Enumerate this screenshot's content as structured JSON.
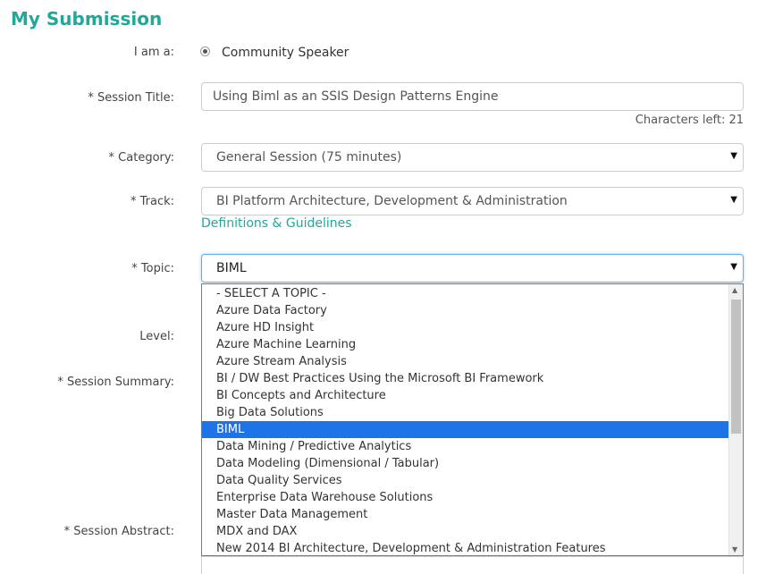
{
  "page": {
    "title": "My Submission"
  },
  "form": {
    "iam_label": "I am a:",
    "iam_value": "Community Speaker",
    "session_title_label": "* Session Title:",
    "session_title_value": "Using Biml as an SSIS Design Patterns Engine",
    "chars_left": "Characters left: 21",
    "category_label": "* Category:",
    "category_value": "General Session (75 minutes)",
    "track_label": "* Track:",
    "track_value": "BI Platform Architecture, Development & Administration",
    "guidelines_link": "Definitions & Guidelines",
    "topic_label": "* Topic:",
    "topic_value": "BIML",
    "level_label": "Level:",
    "summary_label": "* Session Summary:",
    "abstract_label": "* Session Abstract:"
  },
  "topic_dropdown": {
    "options": [
      "- SELECT A TOPIC -",
      "Azure Data Factory",
      "Azure HD Insight",
      "Azure Machine Learning",
      "Azure Stream Analysis",
      "BI / DW Best Practices Using the Microsoft BI Framework",
      "BI Concepts and Architecture",
      "Big Data Solutions",
      "BIML",
      "Data Mining / Predictive Analytics",
      "Data Modeling (Dimensional / Tabular)",
      "Data Quality Services",
      "Enterprise Data Warehouse Solutions",
      "Master Data Management",
      "MDX and DAX",
      "New 2014 BI Architecture, Development & Administration Features"
    ],
    "selected_index": 8
  },
  "colors": {
    "accent": "#1fa99b",
    "selection": "#1e73e6"
  },
  "icons": {
    "dropdown": "caret-down-icon",
    "radio": "radio-selected-icon"
  }
}
